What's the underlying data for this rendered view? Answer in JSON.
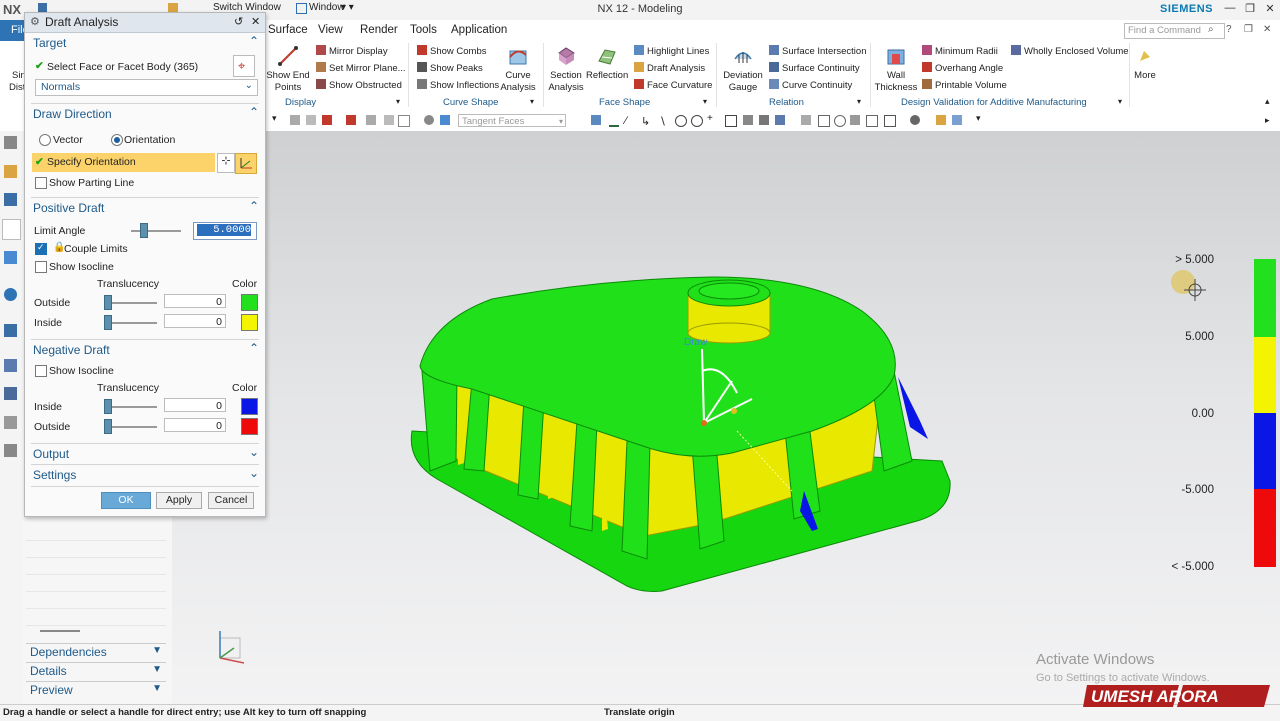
{
  "window": {
    "title": "NX 12 - Modeling",
    "brand": "SIEMENS",
    "app_short": "NX",
    "switch_window": "Switch Window",
    "window_menu": "Window"
  },
  "menu": [
    "File",
    "Surface",
    "View",
    "Render",
    "Tools",
    "Application"
  ],
  "search": {
    "placeholder": "Find a Command"
  },
  "ribbon": {
    "display": {
      "show_end_points": "Show End Points",
      "mirror_display": "Mirror Display",
      "set_mirror_plane": "Set Mirror Plane...",
      "show_obstructed": "Show Obstructed",
      "group": "Display"
    },
    "curve_shape": {
      "show_combs": "Show Combs",
      "show_peaks": "Show Peaks",
      "show_inflections": "Show Inflections",
      "curve_analysis": "Curve Analysis",
      "group": "Curve Shape"
    },
    "face_shape": {
      "section_analysis": "Section Analysis",
      "reflection": "Reflection",
      "highlight_lines": "Highlight Lines",
      "draft_analysis": "Draft Analysis",
      "face_curvature": "Face Curvature",
      "group": "Face Shape"
    },
    "relation": {
      "deviation_gauge": "Deviation Gauge",
      "surface_intersection": "Surface Intersection",
      "surface_continuity": "Surface Continuity",
      "curve_continuity": "Curve Continuity",
      "group": "Relation"
    },
    "design_validation": {
      "wall_thickness": "Wall Thickness",
      "minimum_radii": "Minimum Radii",
      "overhang_angle": "Overhang Angle",
      "printable_volume": "Printable Volume",
      "wholly_enclosed_volume": "Wholly Enclosed Volume",
      "group": "Design Validation for Additive Manufacturing"
    },
    "more": "More",
    "left_cut": [
      "Sin",
      "Dist"
    ]
  },
  "toolbar2": {
    "filter": "Tangent Faces"
  },
  "dialog": {
    "title": "Draft Analysis",
    "target": {
      "header": "Target",
      "select_face": "Select Face or Facet Body (365)",
      "type": "Normals"
    },
    "draw_direction": {
      "header": "Draw Direction",
      "vector": "Vector",
      "orientation": "Orientation",
      "specify_orientation": "Specify Orientation",
      "show_parting_line": "Show Parting Line"
    },
    "positive_draft": {
      "header": "Positive Draft",
      "limit_angle_label": "Limit Angle",
      "limit_angle_value": "5.0000",
      "couple_limits": "Couple Limits",
      "show_isocline": "Show Isocline",
      "translucency": "Translucency",
      "color": "Color",
      "outside": "Outside",
      "inside": "Inside",
      "outside_value": "0",
      "inside_value": "0",
      "outside_color": "#22e01e",
      "inside_color": "#f4f400"
    },
    "negative_draft": {
      "header": "Negative Draft",
      "show_isocline": "Show Isocline",
      "translucency": "Translucency",
      "color": "Color",
      "inside": "Inside",
      "outside": "Outside",
      "inside_value": "0",
      "outside_value": "0",
      "inside_color": "#0a16e6",
      "outside_color": "#ee0a0a"
    },
    "output": "Output",
    "settings": "Settings",
    "ok": "OK",
    "apply": "Apply",
    "cancel": "Cancel"
  },
  "navigator": {
    "dependencies": "Dependencies",
    "details": "Details",
    "preview": "Preview"
  },
  "viewport": {
    "draw_label": "Draw"
  },
  "legend": {
    "labels": [
      "> 5.000",
      "5.000",
      "0.00",
      "-5.000",
      "< -5.000"
    ],
    "colors": [
      "#22e01e",
      "#f4f400",
      "#0a16e6",
      "#ee0a0a"
    ]
  },
  "status": {
    "prompt": "Drag a handle or select a handle for direct entry; use Alt key to turn off snapping",
    "right": "Translate origin"
  },
  "watermark": {
    "line1": "Activate Windows",
    "line2": "Go to Settings to activate Windows.",
    "logo": "UMESH ARORA"
  }
}
